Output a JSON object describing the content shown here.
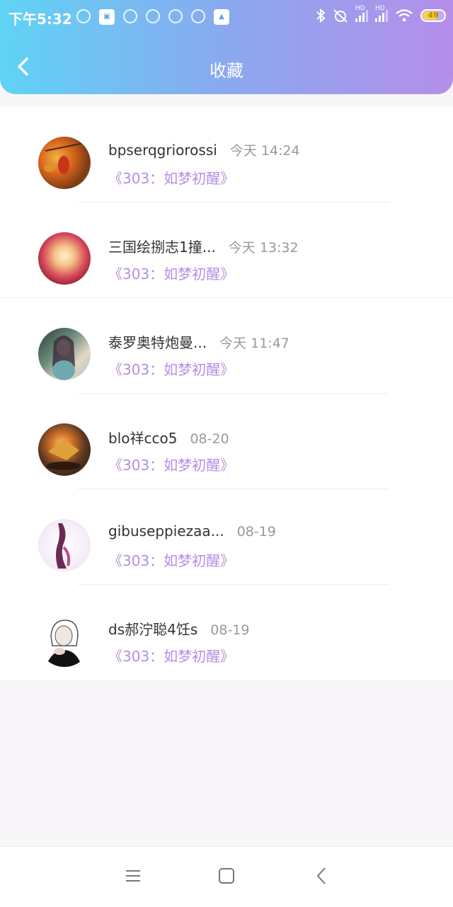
{
  "status_bar": {
    "time": "下午5:32",
    "battery": "49",
    "network_1": "HD",
    "network_2": "HD"
  },
  "header": {
    "title": "收藏"
  },
  "favorites": [
    {
      "name": "bpserqgriorossi",
      "time": "今天 14:24",
      "book": "《303：如梦初醒》",
      "avatar": "autumn-leaves"
    },
    {
      "name": "三国绘捌志1撞...",
      "time": "今天 13:32",
      "book": "《303：如梦初醒》",
      "avatar": "rose"
    },
    {
      "name": "泰罗奥特炮曼...",
      "time": "今天 11:47",
      "book": "《303：如梦初醒》",
      "avatar": "girl-portrait"
    },
    {
      "name": "blo祥cco5",
      "time": "08-20",
      "book": "《303：如梦初醒》",
      "avatar": "autumn-leaf"
    },
    {
      "name": "gibuseppiezaa...",
      "time": "08-19",
      "book": "《303：如梦初醒》",
      "avatar": "illustrated-girl"
    },
    {
      "name": "ds郝泞聪4饪s",
      "time": "08-19",
      "book": "《303：如梦初醒》",
      "avatar": "sketch-girl"
    }
  ],
  "colors": {
    "header_gradient_start": "#5fd3f5",
    "header_gradient_end": "#b58ee9",
    "book_title": "#b58ee0",
    "time_text": "#999999"
  }
}
